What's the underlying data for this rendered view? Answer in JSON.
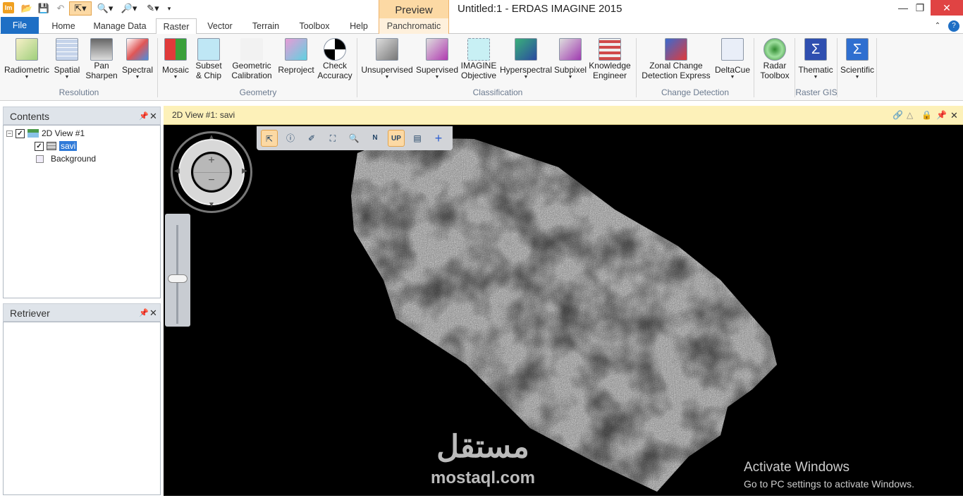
{
  "title_bar": {
    "window_title": "Untitled:1 - ERDAS IMAGINE 2015",
    "context_tab": "Preview",
    "app_icon": "Im"
  },
  "tabs": [
    "File",
    "Home",
    "Manage Data",
    "Raster",
    "Vector",
    "Terrain",
    "Toolbox",
    "Help",
    "Panchromatic"
  ],
  "ribbon": {
    "resolution": {
      "group": "Resolution",
      "buttons": [
        "Radiometric",
        "Spatial",
        "Pan Sharpen",
        "Spectral"
      ]
    },
    "geometry": {
      "group": "Geometry",
      "buttons": [
        "Mosaic",
        "Subset & Chip",
        "Geometric Calibration",
        "Reproject",
        "Check Accuracy"
      ]
    },
    "classification": {
      "group": "Classification",
      "buttons": [
        "Unsupervised",
        "Supervised",
        "IMAGINE Objective",
        "Hyperspectral",
        "Subpixel",
        "Knowledge Engineer"
      ]
    },
    "change_detection": {
      "group": "Change Detection",
      "buttons": [
        "Zonal Change Detection Express",
        "DeltaCue"
      ]
    },
    "radar": {
      "buttons": [
        "Radar Toolbox"
      ]
    },
    "raster_gis": {
      "group": "Raster GIS",
      "buttons": [
        "Thematic"
      ]
    },
    "scientific": {
      "buttons": [
        "Scientific"
      ]
    }
  },
  "contents": {
    "title": "Contents",
    "view": "2D View #1",
    "layer": "savi",
    "background": "Background"
  },
  "retriever": {
    "title": "Retriever"
  },
  "view": {
    "header": "2D View #1: savi"
  },
  "watermark": {
    "arabic": "مستقل",
    "latin": "mostaql.com"
  },
  "activation": {
    "line1": "Activate Windows",
    "line2": "Go to PC settings to activate Windows."
  },
  "colors": {
    "file_tab": "#1e6fc5",
    "preview_tab": "#fcd9a4",
    "view_header": "#fdf1b9",
    "close_button": "#e04343"
  }
}
